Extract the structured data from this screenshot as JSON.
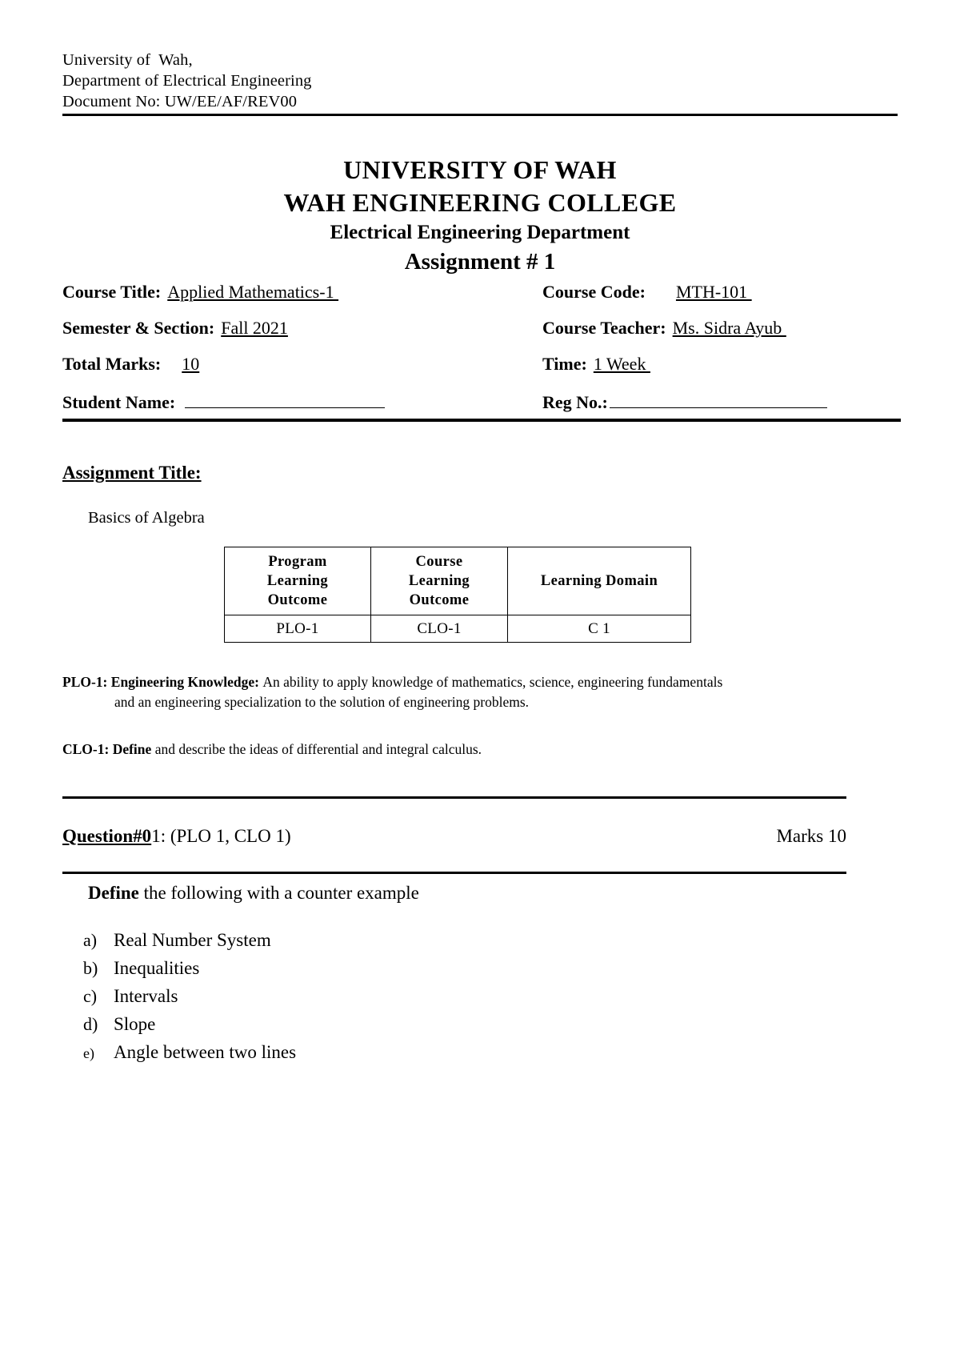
{
  "letterhead": {
    "line1": "University of  Wah,",
    "line2": "Department of Electrical Engineering",
    "line3": "Document No: UW/EE/AF/REV00"
  },
  "title": {
    "university": "UNIVERSITY OF WAH",
    "college": "WAH ENGINEERING COLLEGE",
    "department": "Electrical Engineering Department",
    "assignment": "Assignment # 1"
  },
  "info": {
    "course_title_label": "Course Title:",
    "course_title_value": "Applied Mathematics-1 ",
    "course_code_label": "Course Code:",
    "course_code_value": "MTH-101 ",
    "semester_label": "Semester & Section:",
    "semester_value": "Fall 2021",
    "teacher_label": "Course Teacher:",
    "teacher_value": "Ms. Sidra Ayub ",
    "total_marks_label": "Total Marks:",
    "total_marks_value": "10",
    "time_label": "Time:",
    "time_value": "1 Week ",
    "student_name_label": "Student Name:",
    "student_name_value": "",
    "reg_no_label": "Reg No.:",
    "reg_no_value": ""
  },
  "assignment_title": {
    "heading": "Assignment Title:",
    "value": "Basics of Algebra"
  },
  "outcome_table": {
    "headers": [
      "Program Learning Outcome",
      "Course Learning Outcome",
      "Learning Domain"
    ],
    "headers_wrapped": [
      [
        "Program",
        "Learning",
        "Outcome"
      ],
      [
        "Course",
        "Learning",
        "Outcome"
      ],
      [
        "Learning Domain"
      ]
    ],
    "row": [
      "PLO-1",
      "CLO-1",
      "C 1"
    ]
  },
  "outcomes": {
    "plo_code": "PLO-1: ",
    "plo_name": "Engineering Knowledge: ",
    "plo_text_line1": "An ability to apply knowledge of mathematics, science, engineering fundamentals",
    "plo_text_line2": "and an engineering specialization to the solution of engineering problems.",
    "clo_code": "CLO-1: Define",
    "clo_text": " and describe the ideas of differential and integral calculus."
  },
  "question": {
    "label_bold": "Question#0",
    "label_rest": "1: (PLO 1, CLO 1)",
    "marks": "Marks 10",
    "prompt_bold": "Define",
    "prompt_rest": " the following with a counter example",
    "items": [
      {
        "marker": "a)",
        "text": "Real Number System"
      },
      {
        "marker": "b)",
        "text": "Inequalities"
      },
      {
        "marker": "c)",
        "text": "Intervals"
      },
      {
        "marker": "d)",
        "text": "Slope"
      },
      {
        "marker": "e)",
        "text": "Angle between two lines"
      }
    ]
  }
}
